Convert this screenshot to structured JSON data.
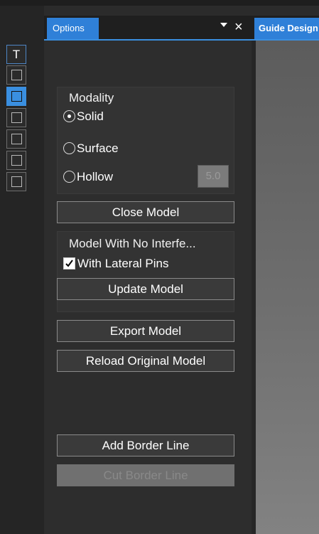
{
  "toolbar": {
    "first_label": "T",
    "buttons": [
      "text-tool",
      "square-tool-1",
      "square-tool-2",
      "square-tool-3",
      "square-tool-4",
      "square-tool-5",
      "square-tool-6"
    ]
  },
  "panel": {
    "tab_label": "Options",
    "pin_icon": "dropdown-pin-icon",
    "close_symbol": "×"
  },
  "modality": {
    "title": "Modality",
    "options": [
      {
        "label": "Solid",
        "checked": true
      },
      {
        "label": "Surface",
        "checked": false
      },
      {
        "label": "Hollow",
        "checked": false
      }
    ],
    "hollow_value": "5.0"
  },
  "buttons": {
    "close_model": "Close Model",
    "update_model": "Update Model",
    "export_model": "Export Model",
    "reload_original_model": "Reload Original Model",
    "add_border_line": "Add Border Line",
    "cut_border_line": "Cut Border Line"
  },
  "interference": {
    "title": "Model With No Interfe...",
    "lateral_pins_label": "With Lateral Pins",
    "lateral_pins_checked": true
  },
  "right": {
    "tab_label": "Guide Design"
  },
  "colors": {
    "accent": "#2f80d8",
    "panel_bg": "#2d2d2d",
    "button_bg": "#3a3a3a"
  }
}
